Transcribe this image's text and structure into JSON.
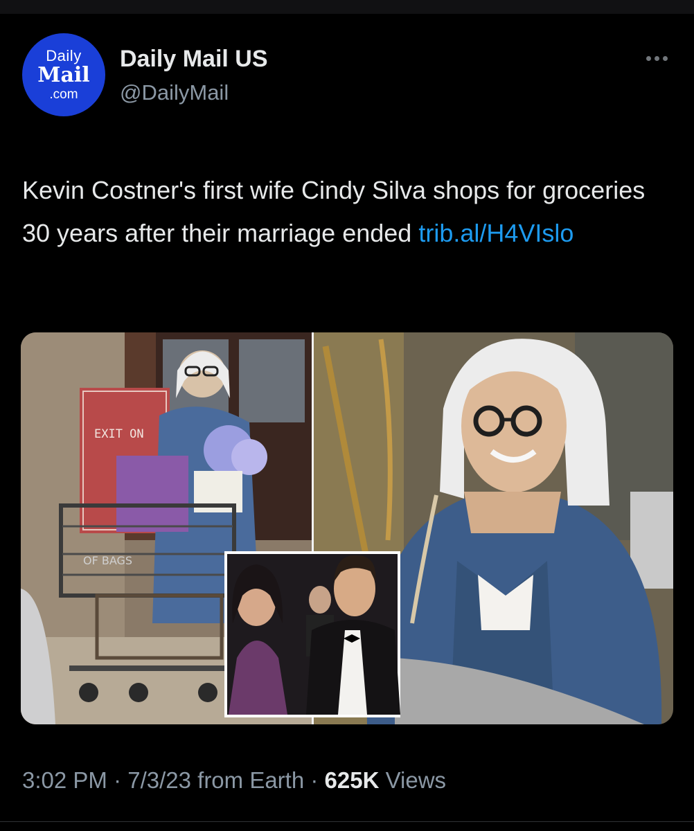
{
  "tweet": {
    "author": {
      "display_name": "Daily Mail US",
      "handle": "@DailyMail",
      "avatar": {
        "line1": "Daily",
        "line2": "Mail",
        "line3": ".com",
        "bg_color": "#1a3fd8"
      }
    },
    "text": "Kevin Costner's first wife Cindy Silva shops for groceries 30 years after their marriage ended",
    "link": "trib.al/H4VIslo",
    "media": {
      "sign_text": "EXIT ON",
      "bag_text": "OF BAGS"
    },
    "meta": {
      "time": "3:02 PM",
      "separator": " · ",
      "date_source": "7/3/23 from Earth",
      "views_count": "625K",
      "views_label": "Views"
    }
  },
  "colors": {
    "link": "#1d9bf0",
    "secondary_text": "#8b98a5",
    "primary_text": "#e7e9ea",
    "background": "#000000"
  }
}
